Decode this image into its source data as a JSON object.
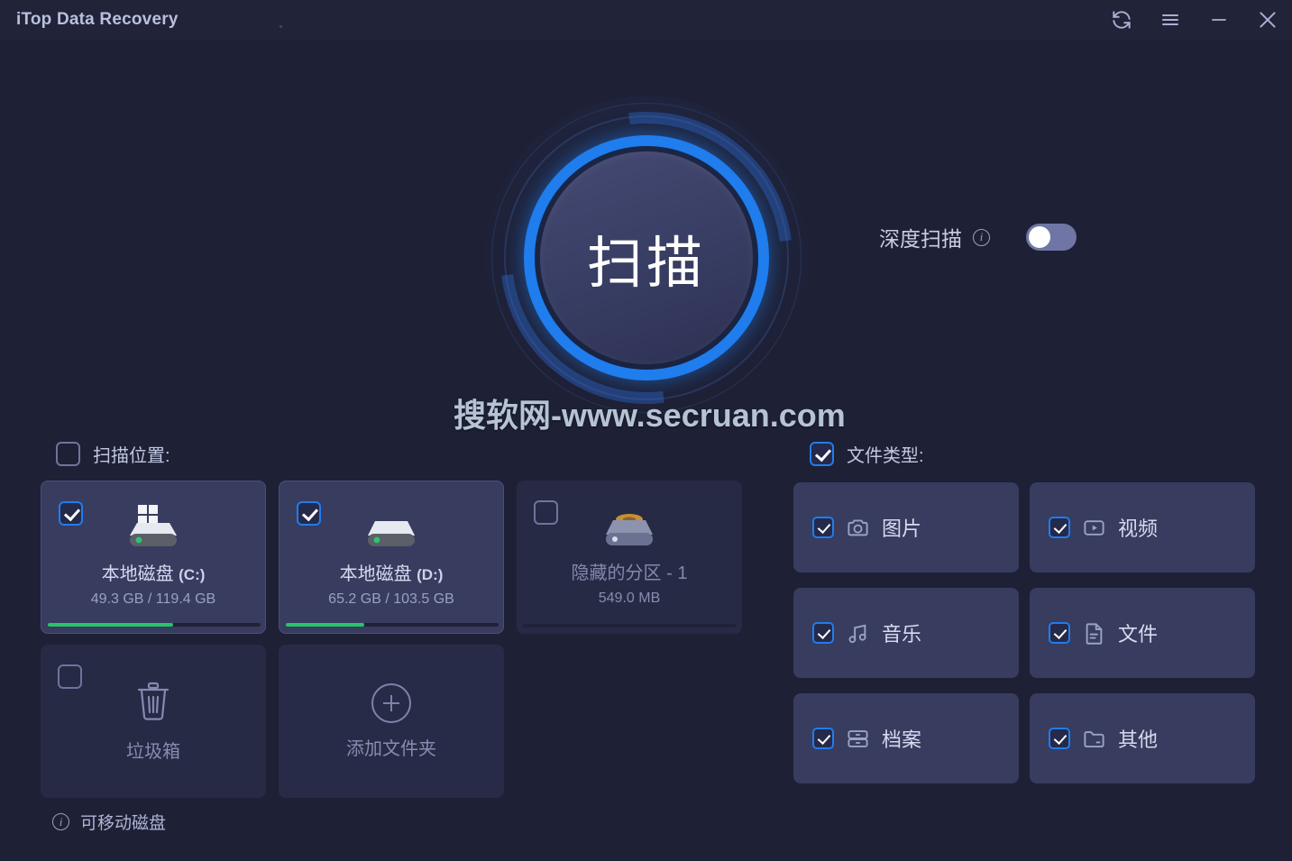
{
  "window": {
    "title": "iTop Data Recovery",
    "controls": [
      {
        "name": "refresh-icon",
        "label": "刷新"
      },
      {
        "name": "menu-icon",
        "label": "菜单"
      },
      {
        "name": "minimize-icon",
        "label": "最小化"
      },
      {
        "name": "close-icon",
        "label": "关闭"
      }
    ]
  },
  "scan": {
    "button_label": "扫描",
    "deep_scan": {
      "label": "深度扫描",
      "info_glyph": "i",
      "enabled": false
    }
  },
  "watermark": "搜软网-www.secruan.com",
  "locations": {
    "header": "扫描位置:",
    "header_checked": false,
    "cards": [
      {
        "id": "drive-c",
        "checked": true,
        "selected": true,
        "dim": false,
        "icon": "windows-drive-icon",
        "title": "本地磁盘",
        "title_suffix": "(C:)",
        "capacity": "49.3 GB / 119.4 GB",
        "usage_percent": 59,
        "has_bar": true
      },
      {
        "id": "drive-d",
        "checked": true,
        "selected": true,
        "dim": false,
        "icon": "drive-icon",
        "title": "本地磁盘",
        "title_suffix": "(D:)",
        "capacity": "65.2 GB / 103.5 GB",
        "usage_percent": 37,
        "has_bar": true
      },
      {
        "id": "hidden-partition-1",
        "checked": false,
        "selected": false,
        "dim": true,
        "icon": "hidden-partition-icon",
        "title": "隐藏的分区 - 1",
        "title_suffix": "",
        "capacity": "549.0 MB",
        "usage_percent": 0,
        "has_bar": true
      }
    ],
    "recycle_bin": {
      "checked": false,
      "icon": "trash-icon",
      "label": "垃圾箱"
    },
    "add_folder": {
      "icon": "plus-circle-icon",
      "label": "添加文件夹"
    },
    "removable_note": {
      "icon": "info-icon",
      "label": "可移动磁盘"
    }
  },
  "file_types": {
    "header": "文件类型:",
    "header_checked": true,
    "items": [
      {
        "id": "pictures",
        "icon": "camera-icon",
        "label": "图片",
        "checked": true
      },
      {
        "id": "videos",
        "icon": "video-icon",
        "label": "视频",
        "checked": true
      },
      {
        "id": "music",
        "icon": "music-icon",
        "label": "音乐",
        "checked": true
      },
      {
        "id": "docs",
        "icon": "document-icon",
        "label": "文件",
        "checked": true
      },
      {
        "id": "archives",
        "icon": "archive-icon",
        "label": "档案",
        "checked": true
      },
      {
        "id": "others",
        "icon": "folder-icon",
        "label": "其他",
        "checked": true
      }
    ]
  },
  "colors": {
    "background": "#1e2035",
    "card": "#383c5f",
    "card_dim": "#272a45",
    "accent_blue": "#1f7ded",
    "progress_green": "#27c46a",
    "text_primary": "#d5daf0",
    "text_muted": "#9aa1c2"
  }
}
